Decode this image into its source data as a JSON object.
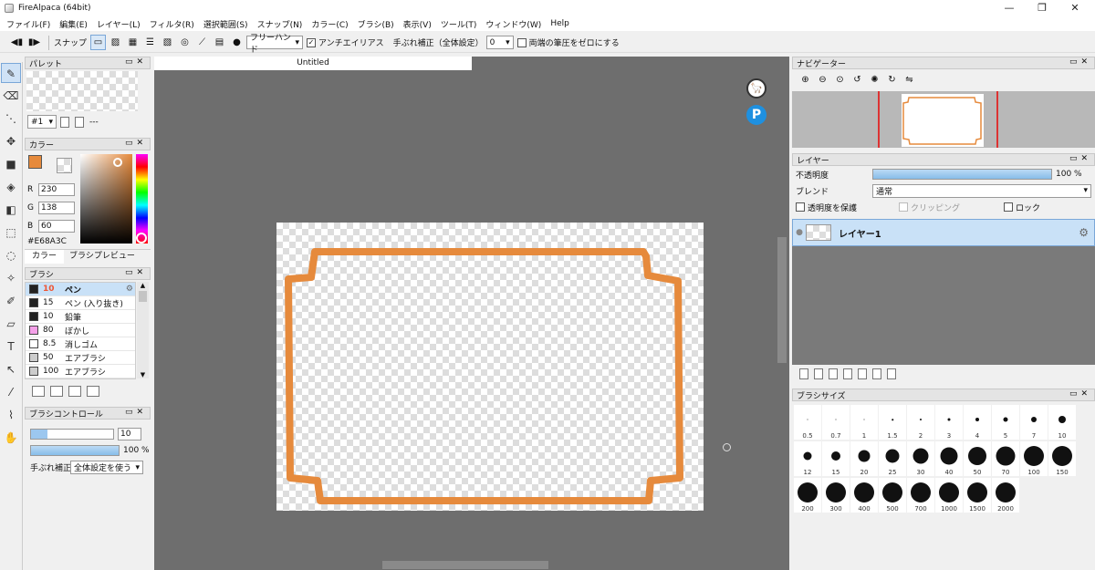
{
  "window": {
    "title": "FireAlpaca (64bit)",
    "minimize": "—",
    "maximize": "❐",
    "close": "✕"
  },
  "menu": [
    "ファイル(F)",
    "編集(E)",
    "レイヤー(L)",
    "フィルタ(R)",
    "選択範囲(S)",
    "スナップ(N)",
    "カラー(C)",
    "ブラシ(B)",
    "表示(V)",
    "ツール(T)",
    "ウィンドウ(W)",
    "Help"
  ],
  "toolbar": {
    "snap_label": "スナップ",
    "draw_mode": "フリーハンド",
    "antialias_label": "アンチエイリアス",
    "antialias_checked": true,
    "stabilizer_label": "手ぶれ補正（全体設定）",
    "stabilizer_value": "0",
    "pressure_label": "両端の筆圧をゼロにする"
  },
  "palette": {
    "title": "パレット",
    "selector": "#1",
    "name": "---"
  },
  "color": {
    "title": "カラー",
    "r_label": "R",
    "r": "230",
    "g_label": "G",
    "g": "138",
    "b_label": "B",
    "b": "60",
    "hex": "#E68A3C",
    "tabs": [
      "カラー",
      "ブラシプレビュー"
    ]
  },
  "brush": {
    "title": "ブラシ",
    "items": [
      {
        "size": "10",
        "name": "ペン",
        "color": "#222222"
      },
      {
        "size": "15",
        "name": "ペン (入り抜き)",
        "color": "#222222"
      },
      {
        "size": "10",
        "name": "鉛筆",
        "color": "#222222"
      },
      {
        "size": "80",
        "name": "ぼかし",
        "color": "#f4a0e8"
      },
      {
        "size": "8.5",
        "name": "消しゴム",
        "color": "#ffffff"
      },
      {
        "size": "50",
        "name": "エアブラシ",
        "color": "#cccccc"
      },
      {
        "size": "100",
        "name": "エアブラシ",
        "color": "#cccccc"
      }
    ]
  },
  "brush_control": {
    "title": "ブラシコントロール",
    "size": "10",
    "opacity": "100 %",
    "stabilizer_label": "手ぶれ補正",
    "stabilizer_value": "全体設定を使う"
  },
  "document": {
    "tab": "Untitled"
  },
  "navigator": {
    "title": "ナビゲーター"
  },
  "layer": {
    "title": "レイヤー",
    "opacity_label": "不透明度",
    "opacity_value": "100 %",
    "opacity_fraction": 1.0,
    "blend_label": "ブレンド",
    "blend_value": "通常",
    "protect_label": "透明度を保護",
    "clipping_label": "クリッピング",
    "lock_label": "ロック",
    "layer_name": "レイヤー1"
  },
  "brush_size": {
    "title": "ブラシサイズ",
    "sizes": [
      "0.5",
      "0.7",
      "1",
      "1.5",
      "2",
      "3",
      "4",
      "5",
      "7",
      "10",
      "12",
      "15",
      "20",
      "25",
      "30",
      "40",
      "50",
      "70",
      "100",
      "150",
      "200",
      "300",
      "400",
      "500",
      "700",
      "1000",
      "1500",
      "2000"
    ]
  },
  "colors": {
    "accent": "#E68A3C",
    "selection": "#c9e1f7"
  }
}
